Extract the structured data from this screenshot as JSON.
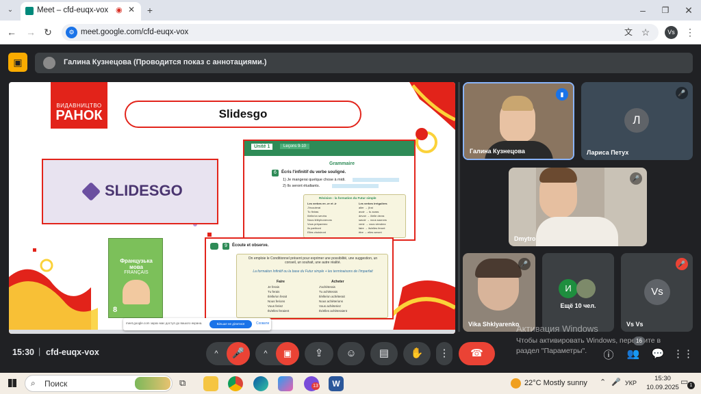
{
  "browser": {
    "tab_title": "Meet – cfd-euqx-vox",
    "url": "meet.google.com/cfd-euqx-vox",
    "profile": "Vs",
    "new_tab_label": "+"
  },
  "meet": {
    "presenter_banner": "Галина Кузнецова (Проводится показ с аннотациями.)",
    "time": "15:30",
    "separator": "|",
    "meeting_code": "cfd-euqx-vox",
    "participant_count": "16",
    "participants": [
      {
        "name": "Галина Кузнецова"
      },
      {
        "name": "Лариса Петух",
        "initial": "Л"
      },
      {
        "name": "Dmytro"
      },
      {
        "name": "Vika Shklyarenko"
      },
      {
        "name": "Ещё 10 чел.",
        "initial": "И"
      },
      {
        "name": "Vs Vs",
        "initial": "Vs"
      }
    ],
    "sharing_notice": "meet.google.com зараз має доступ до вашого екрана.",
    "stop_share_label": "Більше не ділитися",
    "hide_label": "Сховати"
  },
  "slide": {
    "publisher_top": "ВИДАВНИЦТВО",
    "publisher_bottom": "РАНОК",
    "title": "Slidesgo",
    "logo_text": "SLIDESGO",
    "book_title": "Французька мова",
    "book_subtitle": "FRANÇAIS",
    "book_grade": "8",
    "unit_label": "Unité 1",
    "lesson_label": "Leçons 9-10",
    "grammar_heading": "Grammaire",
    "ex6_number": "6",
    "ex6_instruction": "Écris l'infinitif du verbe souligné.",
    "ex6_item1": "1) Je mangerai quelque chose à midi.",
    "ex6_item2": "2) Ils seront étudiants.",
    "revision_heading": "Révision : la formation du Futur simple",
    "revision_left": [
      "Les verbes en -er et -ir",
      "J'écouterai",
      "Tu finiras",
      "Il/elle/on servira",
      "Nous téléphonerons",
      "Vous préparerez",
      "Ils partiront",
      "Elles choisiront"
    ],
    "revision_right": [
      "Les verbes irréguliers",
      "aller → j'irai",
      "avoir → tu auras",
      "devoir → il/elle devra",
      "savoir → nous saurons",
      "venir → vous viendrez",
      "faire → ils/elles feront",
      "être → elles seront"
    ],
    "ex9_number": "9",
    "ex9_instruction": "Écoute et observe.",
    "ex9_text1": "On emploie le Conditionnel présent pour exprimer une possibilité, une suggestion, un conseil, un souhait, une autre réalité.",
    "ex9_text2": "La formation Infinitif ou la base du Futur simple + les terminaisons de l'imparfait",
    "faire_heading": "Faire",
    "acheter_heading": "Acheter",
    "faire_forms": [
      "Je ferais",
      "Tu ferais",
      "Il/elle/on ferait",
      "Nous ferions",
      "Vous feriez",
      "Ils/elles feraient"
    ],
    "acheter_forms": [
      "J'achèterais",
      "Tu achèterais",
      "Il/elle/on achèterait",
      "Nous achèterions",
      "Vous achèteriez",
      "Ils/elles achèteraient"
    ]
  },
  "windows_watermark": {
    "line1": "Активация Windows",
    "line2": "Чтобы активировать Windows, перейдите в",
    "line3": "раздел \"Параметры\"."
  },
  "taskbar": {
    "search_placeholder": "Поиск",
    "weather": "22°C  Mostly sunny",
    "language": "УКР",
    "time": "15:30",
    "date": "10.09.2025",
    "notification_count": "1",
    "badge_count": "13"
  },
  "colors": {
    "accent_red": "#e2231a",
    "meet_bg": "#202124",
    "end_call": "#ea4335",
    "slide_green": "#2e8b57",
    "highlight_blue": "#1a73e8"
  }
}
